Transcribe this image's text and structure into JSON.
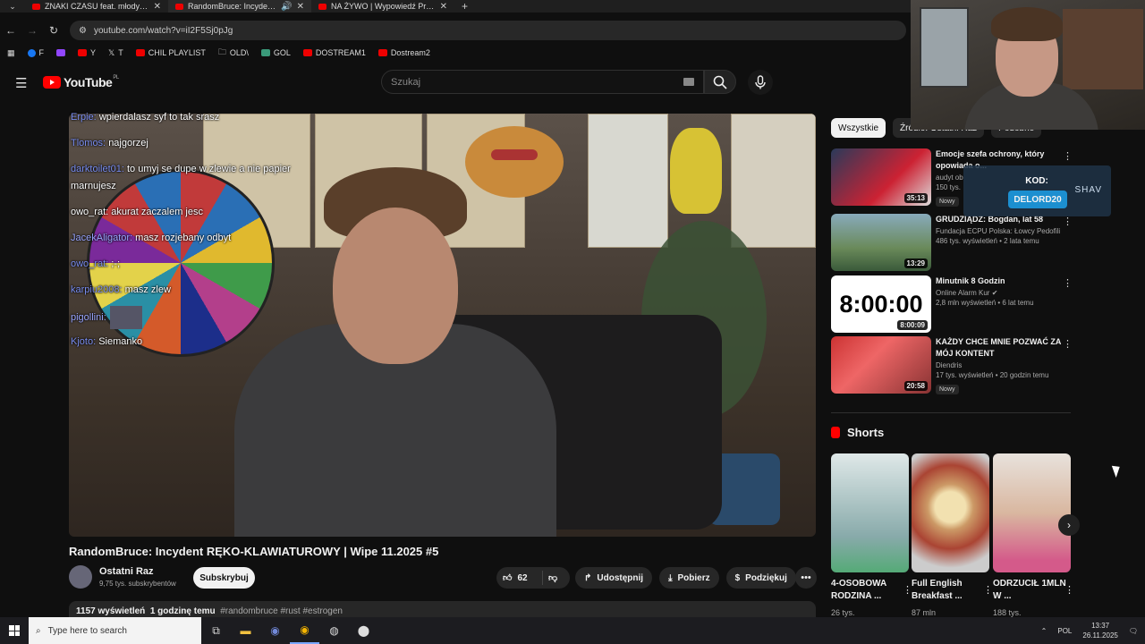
{
  "browser": {
    "tabs": [
      {
        "title": "ZNAKI CZASU feat. młody bębe"
      },
      {
        "title": "RandomBruce: Incydent RĘ"
      },
      {
        "title": "NA ŻYWO | Wypowiedź Premie"
      }
    ],
    "url": "youtube.com/watch?v=iI2F5Sj0pJg",
    "bookmarks": [
      "F",
      "Y",
      "T",
      "CHIL PLAYLIST",
      "OLD\\",
      "GOL",
      "DOSTREAM1",
      "Dostream2"
    ]
  },
  "header": {
    "logo": "YouTube",
    "region": "PL",
    "search_placeholder": "Szukaj"
  },
  "chat": [
    {
      "user": "Erpie:",
      "text": "wpierdalasz syf to tak srasz"
    },
    {
      "user": "Tlomos:",
      "text": "najgorzej"
    },
    {
      "user": "darktoilet01:",
      "text": "to umyj se dupe w zlewie a nie papier"
    },
    {
      "user": "",
      "text": "marnujesz"
    },
    {
      "user": "owo_rat:",
      "text": "akurat zaczalem jesc"
    },
    {
      "user": "JacekAligator:",
      "text": "masz rozjebany odbyt"
    },
    {
      "user": "owo_rat:",
      "text": ";-;"
    },
    {
      "user": "karpiu2008:",
      "text": "masz zlew"
    },
    {
      "user": "pigollini:",
      "text": ""
    },
    {
      "user": "Kjoto:",
      "text": "Siemanko"
    }
  ],
  "video": {
    "title": "RandomBruce: Incydent RĘKO-KLAWIATUROWY | Wipe 11.2025 #5",
    "channel": "Ostatni Raz",
    "subscribers": "9,75 tys. subskrybentów",
    "subscribe_label": "Subskrybuj",
    "likes": "62",
    "share_label": "Udostępnij",
    "download_label": "Pobierz",
    "thanks_label": "Podziękuj",
    "views": "1157 wyświetleń",
    "age": "1 godzinę temu",
    "tags": "#randombruce #rust #estrogen"
  },
  "chips": [
    "Wszystkie",
    "Źródło: Ostatni Raz",
    "Podobne"
  ],
  "recommended": [
    {
      "title": "Emocje szefa ochrony, który opowiada o...",
      "channel": "audyt ob",
      "meta": "150 tys.",
      "duration": "35:13",
      "badge": "Nowy"
    },
    {
      "title": "GRUDZIĄDZ: Bogdan, lat 58",
      "channel": "Fundacja ECPU Polska: Łowcy Pedofili",
      "meta": "486 tys. wyświetleń • 2 lata temu",
      "duration": "13:29",
      "badge": ""
    },
    {
      "title": "Minutnik 8 Godzin",
      "channel": "Online Alarm Kur",
      "meta": "2,8 mln wyświetleń • 6 lat temu",
      "duration": "8:00:09",
      "badge": "",
      "thumb_text": "8:00:00"
    },
    {
      "title": "KAŻDY CHCE MNIE POZWAĆ ZA MÓJ KONTENT",
      "channel": "Diendris",
      "meta": "17 tys. wyświetleń • 20 godzin temu",
      "duration": "20:58",
      "badge": "Nowy"
    }
  ],
  "shorts": {
    "heading": "Shorts",
    "items": [
      {
        "title": "4-OSOBOWA RODZINA ...",
        "views": "26 tys."
      },
      {
        "title": "Full English Breakfast ...",
        "views": "87 mln"
      },
      {
        "title": "ODRZUCIŁ 1MLN W ...",
        "views": "188 tys."
      }
    ]
  },
  "overlay": {
    "line1": "KOD:",
    "code": "DELORD20",
    "brand": "SHAV"
  },
  "taskbar": {
    "search_placeholder": "Type here to search",
    "lang": "POL",
    "time": "13:37",
    "date": "26.11.2025"
  }
}
